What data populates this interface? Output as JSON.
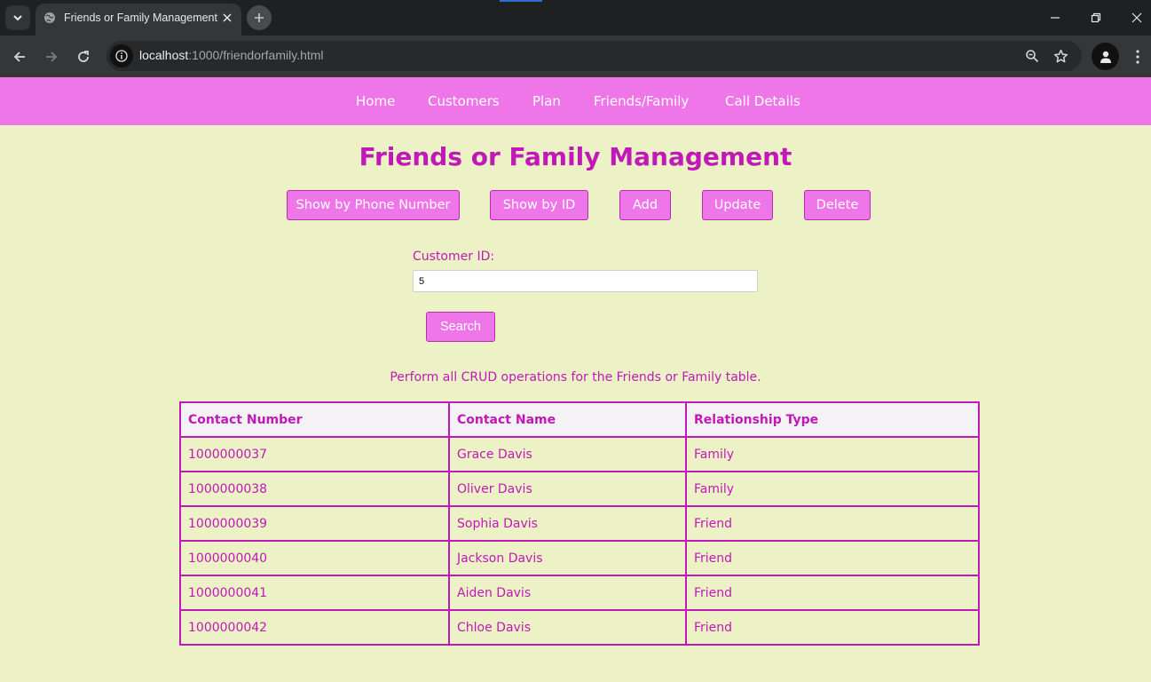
{
  "browser": {
    "tab_title": "Friends or Family Management",
    "url_host": "localhost",
    "url_rest": ":1000/friendorfamily.html"
  },
  "nav": {
    "items": [
      "Home",
      "Customers",
      "Plan",
      "Friends/Family",
      "Call Details"
    ]
  },
  "page": {
    "title": "Friends or Family Management",
    "buttons": [
      "Show by Phone Number",
      "Show by ID",
      "Add",
      "Update",
      "Delete"
    ],
    "field_label": "Customer ID:",
    "field_value": "5",
    "search_label": "Search",
    "info": "Perform all CRUD operations for the Friends or Family table."
  },
  "table": {
    "headers": [
      "Contact Number",
      "Contact Name",
      "Relationship Type"
    ],
    "rows": [
      [
        "1000000037",
        "Grace Davis",
        "Family"
      ],
      [
        "1000000038",
        "Oliver Davis",
        "Family"
      ],
      [
        "1000000039",
        "Sophia Davis",
        "Friend"
      ],
      [
        "1000000040",
        "Jackson Davis",
        "Friend"
      ],
      [
        "1000000041",
        "Aiden Davis",
        "Friend"
      ],
      [
        "1000000042",
        "Chloe Davis",
        "Friend"
      ]
    ]
  },
  "colors": {
    "nav_bg": "#ee76e8",
    "accent": "#c118b8",
    "page_bg": "#edf2c6"
  },
  "icons": [
    "tab-list-icon",
    "globe-icon",
    "close-icon",
    "plus-icon",
    "minimize-icon",
    "restore-icon",
    "back-icon",
    "forward-icon",
    "reload-icon",
    "site-info-icon",
    "zoom-icon",
    "star-icon",
    "profile-icon",
    "menu-icon"
  ]
}
